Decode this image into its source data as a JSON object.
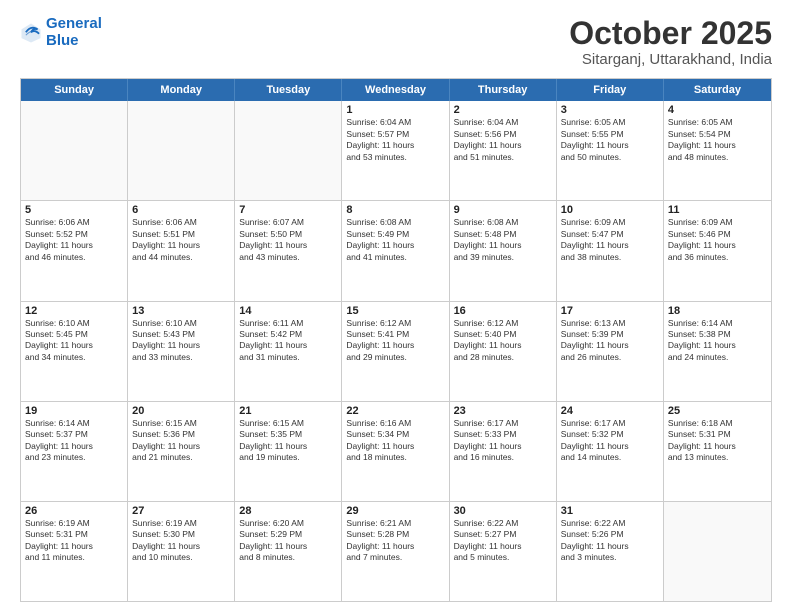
{
  "header": {
    "logo_line1": "General",
    "logo_line2": "Blue",
    "month": "October 2025",
    "location": "Sitarganj, Uttarakhand, India"
  },
  "days_of_week": [
    "Sunday",
    "Monday",
    "Tuesday",
    "Wednesday",
    "Thursday",
    "Friday",
    "Saturday"
  ],
  "weeks": [
    [
      {
        "day": "",
        "info": ""
      },
      {
        "day": "",
        "info": ""
      },
      {
        "day": "",
        "info": ""
      },
      {
        "day": "1",
        "info": "Sunrise: 6:04 AM\nSunset: 5:57 PM\nDaylight: 11 hours\nand 53 minutes."
      },
      {
        "day": "2",
        "info": "Sunrise: 6:04 AM\nSunset: 5:56 PM\nDaylight: 11 hours\nand 51 minutes."
      },
      {
        "day": "3",
        "info": "Sunrise: 6:05 AM\nSunset: 5:55 PM\nDaylight: 11 hours\nand 50 minutes."
      },
      {
        "day": "4",
        "info": "Sunrise: 6:05 AM\nSunset: 5:54 PM\nDaylight: 11 hours\nand 48 minutes."
      }
    ],
    [
      {
        "day": "5",
        "info": "Sunrise: 6:06 AM\nSunset: 5:52 PM\nDaylight: 11 hours\nand 46 minutes."
      },
      {
        "day": "6",
        "info": "Sunrise: 6:06 AM\nSunset: 5:51 PM\nDaylight: 11 hours\nand 44 minutes."
      },
      {
        "day": "7",
        "info": "Sunrise: 6:07 AM\nSunset: 5:50 PM\nDaylight: 11 hours\nand 43 minutes."
      },
      {
        "day": "8",
        "info": "Sunrise: 6:08 AM\nSunset: 5:49 PM\nDaylight: 11 hours\nand 41 minutes."
      },
      {
        "day": "9",
        "info": "Sunrise: 6:08 AM\nSunset: 5:48 PM\nDaylight: 11 hours\nand 39 minutes."
      },
      {
        "day": "10",
        "info": "Sunrise: 6:09 AM\nSunset: 5:47 PM\nDaylight: 11 hours\nand 38 minutes."
      },
      {
        "day": "11",
        "info": "Sunrise: 6:09 AM\nSunset: 5:46 PM\nDaylight: 11 hours\nand 36 minutes."
      }
    ],
    [
      {
        "day": "12",
        "info": "Sunrise: 6:10 AM\nSunset: 5:45 PM\nDaylight: 11 hours\nand 34 minutes."
      },
      {
        "day": "13",
        "info": "Sunrise: 6:10 AM\nSunset: 5:43 PM\nDaylight: 11 hours\nand 33 minutes."
      },
      {
        "day": "14",
        "info": "Sunrise: 6:11 AM\nSunset: 5:42 PM\nDaylight: 11 hours\nand 31 minutes."
      },
      {
        "day": "15",
        "info": "Sunrise: 6:12 AM\nSunset: 5:41 PM\nDaylight: 11 hours\nand 29 minutes."
      },
      {
        "day": "16",
        "info": "Sunrise: 6:12 AM\nSunset: 5:40 PM\nDaylight: 11 hours\nand 28 minutes."
      },
      {
        "day": "17",
        "info": "Sunrise: 6:13 AM\nSunset: 5:39 PM\nDaylight: 11 hours\nand 26 minutes."
      },
      {
        "day": "18",
        "info": "Sunrise: 6:14 AM\nSunset: 5:38 PM\nDaylight: 11 hours\nand 24 minutes."
      }
    ],
    [
      {
        "day": "19",
        "info": "Sunrise: 6:14 AM\nSunset: 5:37 PM\nDaylight: 11 hours\nand 23 minutes."
      },
      {
        "day": "20",
        "info": "Sunrise: 6:15 AM\nSunset: 5:36 PM\nDaylight: 11 hours\nand 21 minutes."
      },
      {
        "day": "21",
        "info": "Sunrise: 6:15 AM\nSunset: 5:35 PM\nDaylight: 11 hours\nand 19 minutes."
      },
      {
        "day": "22",
        "info": "Sunrise: 6:16 AM\nSunset: 5:34 PM\nDaylight: 11 hours\nand 18 minutes."
      },
      {
        "day": "23",
        "info": "Sunrise: 6:17 AM\nSunset: 5:33 PM\nDaylight: 11 hours\nand 16 minutes."
      },
      {
        "day": "24",
        "info": "Sunrise: 6:17 AM\nSunset: 5:32 PM\nDaylight: 11 hours\nand 14 minutes."
      },
      {
        "day": "25",
        "info": "Sunrise: 6:18 AM\nSunset: 5:31 PM\nDaylight: 11 hours\nand 13 minutes."
      }
    ],
    [
      {
        "day": "26",
        "info": "Sunrise: 6:19 AM\nSunset: 5:31 PM\nDaylight: 11 hours\nand 11 minutes."
      },
      {
        "day": "27",
        "info": "Sunrise: 6:19 AM\nSunset: 5:30 PM\nDaylight: 11 hours\nand 10 minutes."
      },
      {
        "day": "28",
        "info": "Sunrise: 6:20 AM\nSunset: 5:29 PM\nDaylight: 11 hours\nand 8 minutes."
      },
      {
        "day": "29",
        "info": "Sunrise: 6:21 AM\nSunset: 5:28 PM\nDaylight: 11 hours\nand 7 minutes."
      },
      {
        "day": "30",
        "info": "Sunrise: 6:22 AM\nSunset: 5:27 PM\nDaylight: 11 hours\nand 5 minutes."
      },
      {
        "day": "31",
        "info": "Sunrise: 6:22 AM\nSunset: 5:26 PM\nDaylight: 11 hours\nand 3 minutes."
      },
      {
        "day": "",
        "info": ""
      }
    ]
  ]
}
